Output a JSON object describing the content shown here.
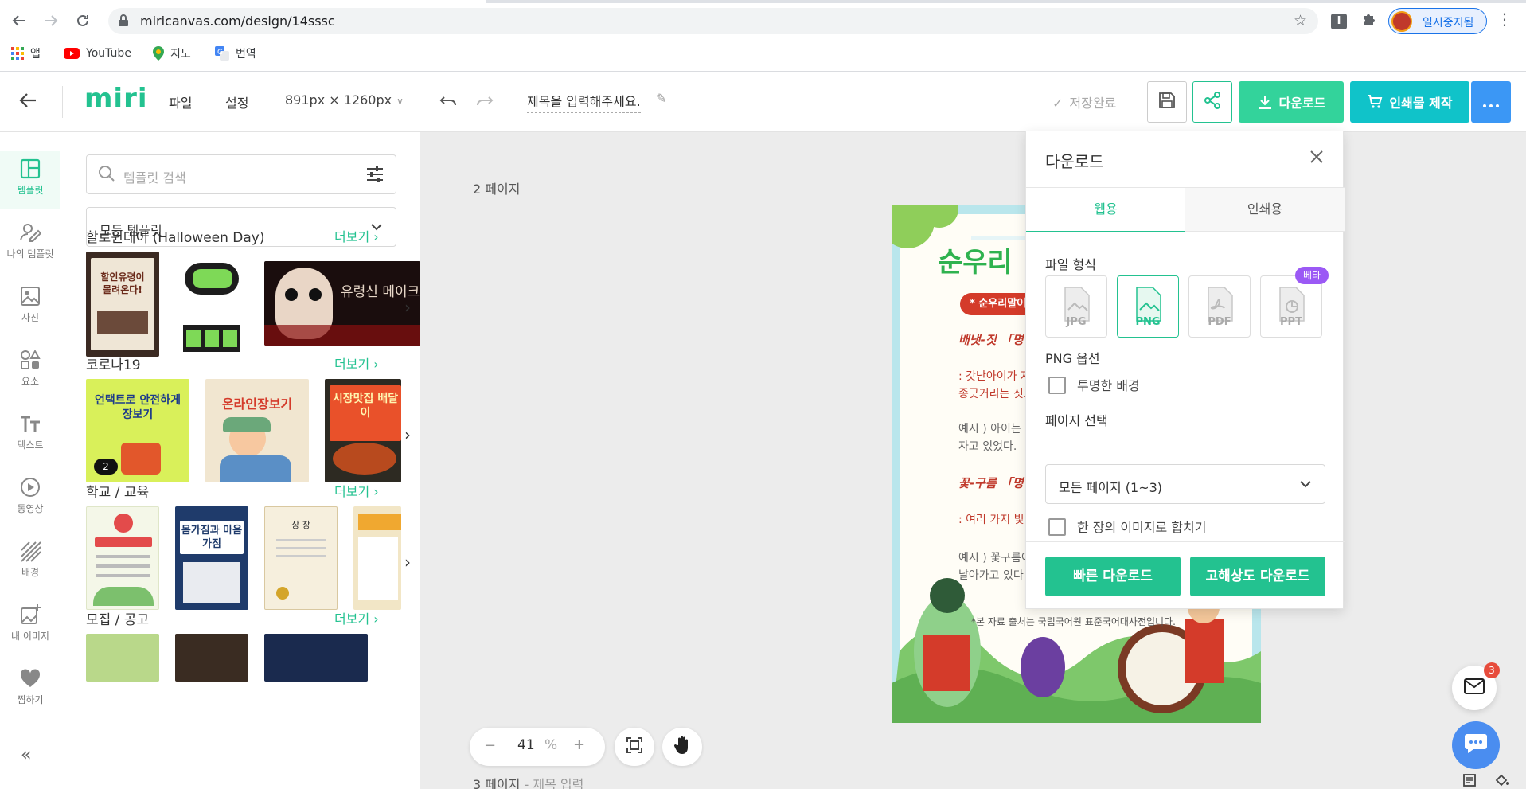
{
  "browser": {
    "url": "miricanvas.com/design/14sssc",
    "profile_name": "일시중지됨",
    "bookmarks": [
      "앱",
      "YouTube",
      "지도",
      "번역"
    ]
  },
  "header": {
    "logo": "miri",
    "menu_file": "파일",
    "menu_settings": "설정",
    "canvas_size": "891px × 1260px",
    "title_placeholder": "제목을 입력해주세요.",
    "save_status": "저장완료",
    "download_label": "다운로드",
    "print_label": "인쇄물 제작"
  },
  "rail": {
    "items": [
      {
        "label": "템플릿",
        "icon": "template-icon"
      },
      {
        "label": "나의 템플릿",
        "icon": "my-template-icon"
      },
      {
        "label": "사진",
        "icon": "photo-icon"
      },
      {
        "label": "요소",
        "icon": "elements-icon"
      },
      {
        "label": "텍스트",
        "icon": "text-icon"
      },
      {
        "label": "동영상",
        "icon": "video-icon"
      },
      {
        "label": "배경",
        "icon": "background-icon"
      },
      {
        "label": "내 이미지",
        "icon": "my-image-icon"
      },
      {
        "label": "찜하기",
        "icon": "heart-icon"
      }
    ]
  },
  "panel": {
    "search_placeholder": "템플릿 검색",
    "category": "모든 템플릿",
    "more_label": "더보기",
    "sections": [
      {
        "title": "할로윈데이 (Halloween Day)"
      },
      {
        "title": "코로나19"
      },
      {
        "title": "학교 / 교육"
      },
      {
        "title": "모집 / 공고"
      }
    ],
    "thumb_texts": {
      "h1": "할인유령이 몰려온다!",
      "h3": "유령신 메이크",
      "c1": "언택트로 안전하게 장보기",
      "c1_badge": "2",
      "c2": "온라인장보기",
      "c3": "시장맛집 배달이",
      "s2": "몸가짐과 마음가짐",
      "s3": "상 장"
    }
  },
  "workspace": {
    "page_label": "2 페이지",
    "bottom_page_label": "3 페이지",
    "bottom_page_title": "- 제목 입력",
    "zoom": "41",
    "zoom_unit": "%",
    "mail_badge": "3"
  },
  "design": {
    "title": "순우리",
    "badge": "* 순우리말이",
    "line1": "배냇-짓 「명",
    "line2": ": 갓난아이가 자",
    "line3": "종긋거리는 짓.",
    "line4": "예시 ) 아이는",
    "line5": "자고 있었다.",
    "line6": "꽃-구름 「명",
    "line7": ": 여러 가지 빛",
    "line8": "예시 ) 꽃구름이",
    "line9": "날아가고 있다",
    "footer": "*본 자료 출처는 국립국어원 표준국어대사전입니다."
  },
  "download": {
    "title": "다운로드",
    "tab_web": "웹용",
    "tab_print": "인쇄용",
    "format_label": "파일 형식",
    "formats": [
      "JPG",
      "PNG",
      "PDF",
      "PPT"
    ],
    "selected_format": "PNG",
    "beta": "베타",
    "png_options_label": "PNG 옵션",
    "transparent_bg": "투명한 배경",
    "page_select_label": "페이지 선택",
    "page_select_value": "모든 페이지 (1~3)",
    "merge_label": "한 장의 이미지로 합치기",
    "fast_download": "빠른 다운로드",
    "hires_download": "고해상도 다운로드"
  },
  "colors": {
    "brand_green": "#23c290",
    "download_green": "#33d39b",
    "print_teal": "#10c3c9",
    "more_blue": "#3b97f5",
    "beta_purple": "#9b59f5"
  }
}
